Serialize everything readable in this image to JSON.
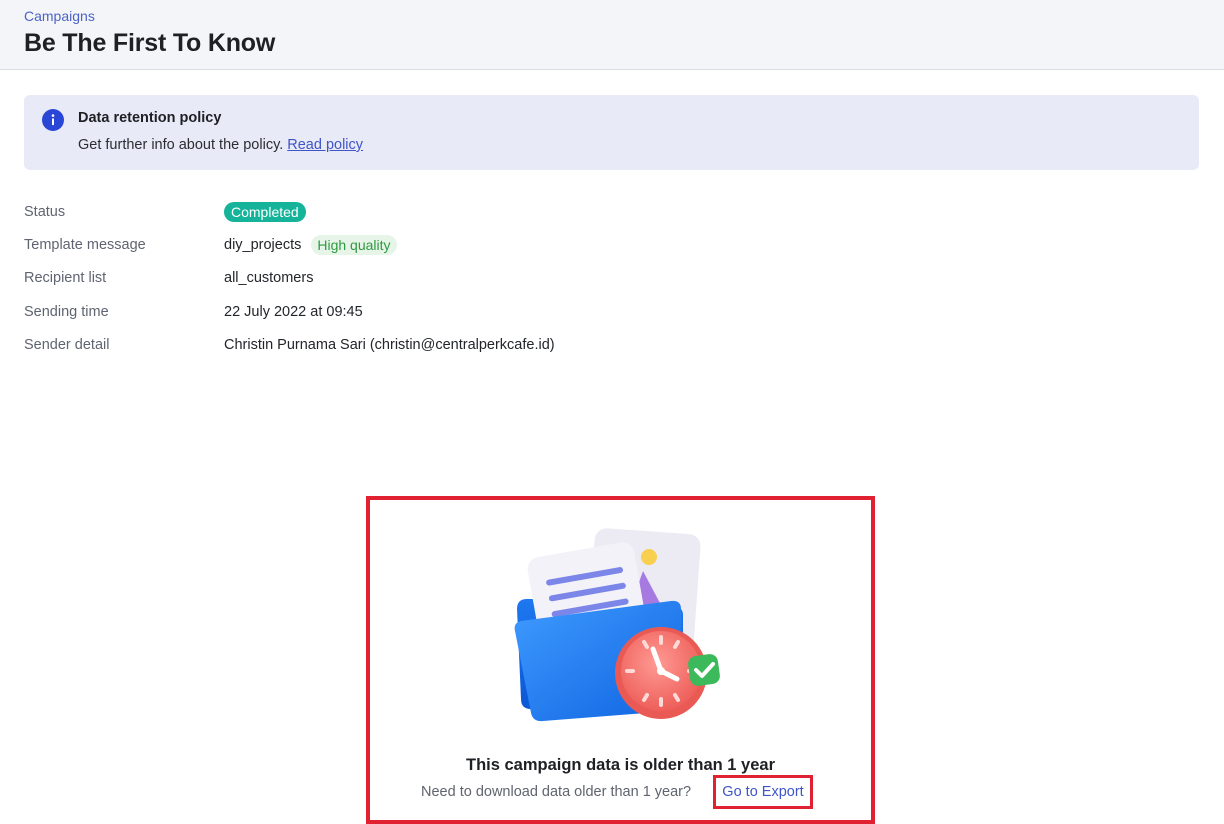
{
  "header": {
    "breadcrumb": "Campaigns",
    "title": "Be The First To Know"
  },
  "banner": {
    "icon": "info-icon",
    "title": "Data retention policy",
    "text": "Get further info about the policy.",
    "link": "Read policy"
  },
  "details": {
    "status_label": "Status",
    "status_value": "Completed",
    "template_label": "Template message",
    "template_value": "diy_projects",
    "template_badge": "High quality",
    "recipient_label": "Recipient list",
    "recipient_value": "all_customers",
    "sending_label": "Sending time",
    "sending_value": "22 July 2022 at 09:45",
    "sender_label": "Sender detail",
    "sender_value": "Christin Purnama Sari (christin@centralperkcafe.id)"
  },
  "empty_state": {
    "illustration": "folder-clock-illustration",
    "title": "This campaign data is older than 1 year",
    "text": "Need to download data older than 1 year?",
    "link": "Go to Export"
  },
  "colors": {
    "accent": "#3f55c6",
    "status_completed": "#14b39a",
    "quality_badge_bg": "#e6f5e8",
    "quality_badge_text": "#2f9a41",
    "highlight": "#e02131"
  }
}
